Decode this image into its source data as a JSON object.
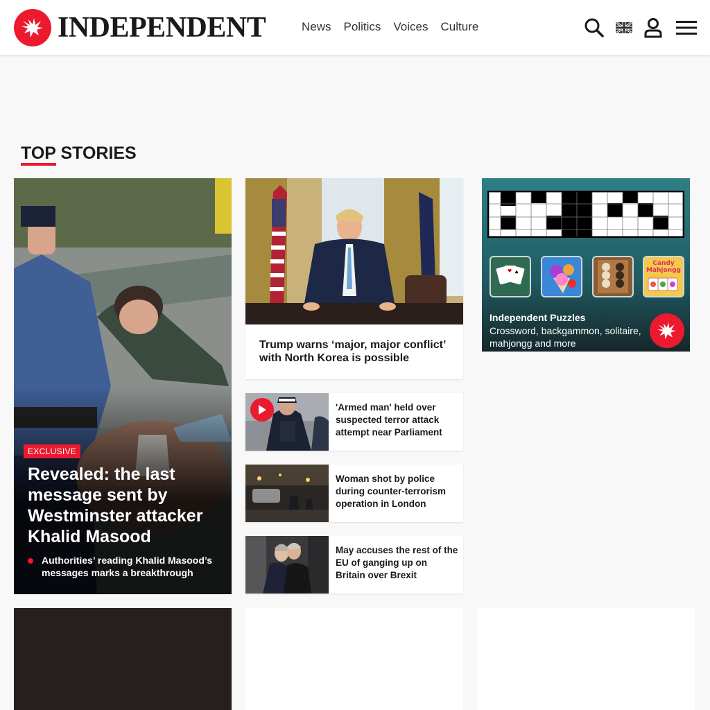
{
  "header": {
    "logo_text": "INDEPENDENT",
    "nav": [
      "News",
      "Politics",
      "Voices",
      "Culture"
    ]
  },
  "section": {
    "title_underlined": "TOP",
    "title_rest": " STORIES"
  },
  "lead": {
    "badge": "EXCLUSIVE",
    "headline": "Revealed: the last message sent by Westminster attacker Khalid Masood",
    "subline": "Authorities’ reading Khalid Masood’s messages marks a breakthrough"
  },
  "feature": {
    "title": "Trump warns ‘major, major conflict’ with North Korea is possible"
  },
  "small_stories": [
    {
      "title": "'Armed man' held over suspected terror attack attempt near Parliament"
    },
    {
      "title": "Woman shot by police during counter-terrorism operation in London"
    },
    {
      "title": "May accuses the rest of the EU of ganging up on Britain over Brexit"
    }
  ],
  "puzzles": {
    "title": "Independent Puzzles",
    "subtitle": "Crossword, backgammon, solitaire, mahjongg and more",
    "tile_text": "Candy Mahjongg"
  },
  "colors": {
    "brand_red": "#ec1a2e",
    "header_bg": "#ffffff",
    "page_bg": "#f8f8f8"
  },
  "icons": [
    "search-icon",
    "uk-flag-icon",
    "user-icon",
    "menu-icon",
    "play-icon",
    "eagle-logo-icon"
  ]
}
